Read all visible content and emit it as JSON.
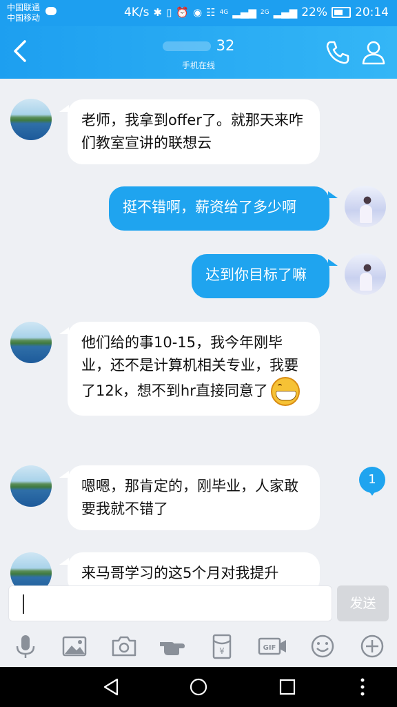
{
  "status_bar": {
    "carrier1": "中国联通",
    "carrier2": "中国移动",
    "speed": "4K/s",
    "signal1": "4G",
    "signal2": "2G",
    "battery": "22%",
    "time": "20:14"
  },
  "header": {
    "title_suffix": "32",
    "subtitle": "手机在线"
  },
  "messages": [
    {
      "dir": "in",
      "text": "老师，我拿到offer了。就那天来咋们教室宣讲的联想云"
    },
    {
      "dir": "out",
      "text": "挺不错啊，薪资给了多少啊"
    },
    {
      "dir": "out",
      "text": "达到你目标了嘛"
    },
    {
      "dir": "in",
      "text": "他们给的事10-15，我今年刚毕业，还不是计算机相关专业，我要了12k，想不到hr直接同意了"
    },
    {
      "dir": "in",
      "text": "嗯嗯，那肯定的，刚毕业，人家敢要我就不错了"
    },
    {
      "dir": "in",
      "text": "来马哥学习的这5个月对我提升"
    }
  ],
  "unread_count": "1",
  "input": {
    "value": "",
    "send_label": "发送"
  },
  "toolbar": {
    "icons": [
      "mic-icon",
      "image-icon",
      "camera-icon",
      "poke-icon",
      "red-packet-icon",
      "gif-icon",
      "emoji-icon",
      "add-icon"
    ]
  },
  "colors": {
    "accent": "#1fa4ef",
    "header": "#1d9ff0",
    "background": "#eef0f4"
  }
}
